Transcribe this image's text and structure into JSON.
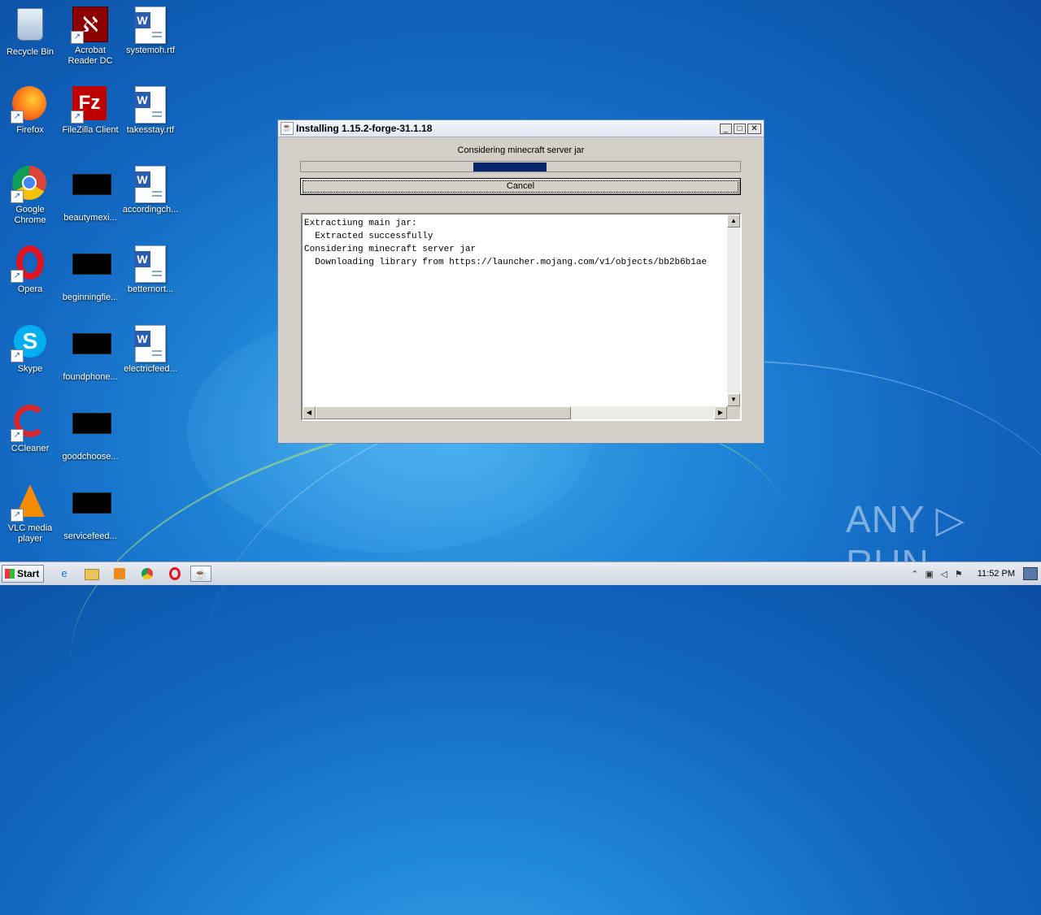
{
  "desktop": {
    "icons": [
      {
        "label": "Recycle Bin",
        "icon": "recycle-bin-icon"
      },
      {
        "label": "Acrobat Reader DC",
        "icon": "acrobat-icon"
      },
      {
        "label": "systemoh.rtf",
        "icon": "word-doc-icon"
      },
      {
        "label": "Firefox",
        "icon": "firefox-icon"
      },
      {
        "label": "FileZilla Client",
        "icon": "filezilla-icon"
      },
      {
        "label": "takesstay.rtf",
        "icon": "word-doc-icon"
      },
      {
        "label": "Google Chrome",
        "icon": "chrome-icon"
      },
      {
        "label": "beautymexi...",
        "icon": "black-file-icon"
      },
      {
        "label": "accordingch...",
        "icon": "word-doc-icon"
      },
      {
        "label": "Opera",
        "icon": "opera-icon"
      },
      {
        "label": "beginningfie...",
        "icon": "black-file-icon"
      },
      {
        "label": "betternort...",
        "icon": "word-doc-icon"
      },
      {
        "label": "Skype",
        "icon": "skype-icon"
      },
      {
        "label": "foundphone...",
        "icon": "black-file-icon"
      },
      {
        "label": "electricfeed...",
        "icon": "word-doc-icon"
      },
      {
        "label": "CCleaner",
        "icon": "ccleaner-icon"
      },
      {
        "label": "goodchoose...",
        "icon": "black-file-icon"
      },
      {
        "label": "VLC media player",
        "icon": "vlc-icon"
      },
      {
        "label": "servicefeed...",
        "icon": "black-file-icon"
      }
    ]
  },
  "window": {
    "title": "Installing 1.15.2-forge-31.1.18",
    "status": "Considering minecraft server jar",
    "cancel_label": "Cancel",
    "log": "Extractiung main jar:\n  Extracted successfully\nConsidering minecraft server jar\n  Downloading library from https://launcher.mojang.com/v1/objects/bb2b6b1ae",
    "buttons": {
      "minimize": "_",
      "maximize": "□",
      "close": "✕"
    }
  },
  "watermark": "ANY ▷ RUN",
  "taskbar": {
    "start_label": "Start",
    "clock": "11:52 PM",
    "items": [
      "ie-icon",
      "explorer-icon",
      "media-player-icon",
      "chrome-icon",
      "opera-icon",
      "java-installer-icon"
    ]
  },
  "colors": {
    "progress": "#0a246a",
    "title_bg": "#e1e8f2"
  }
}
